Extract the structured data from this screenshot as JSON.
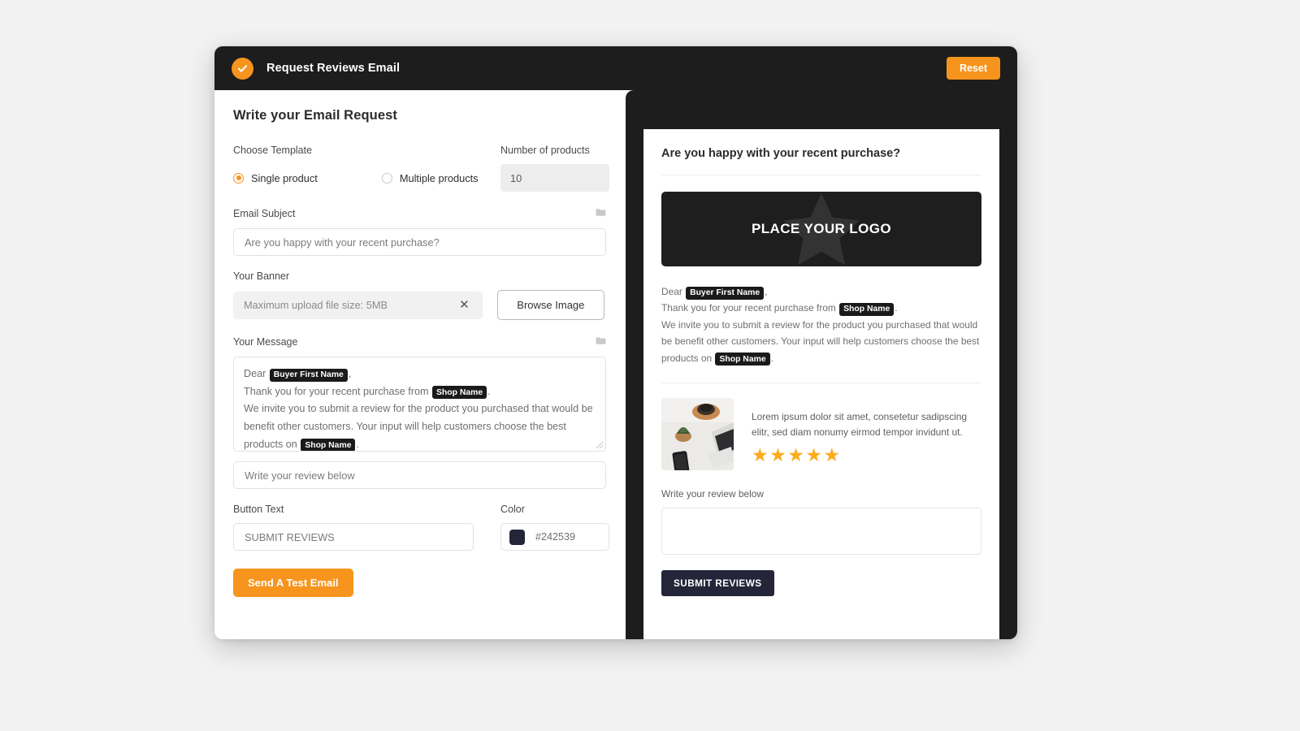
{
  "window": {
    "title": "Request Reviews Email",
    "brand_icon": "check-circle-icon",
    "reset_label": "Reset",
    "accent_color": "#f7941d",
    "titlebar_color": "#1d1d1d"
  },
  "form": {
    "panel_title": "Write your Email Request",
    "template": {
      "label": "Choose Template",
      "options": [
        {
          "label": "Single product",
          "selected": true
        },
        {
          "label": "Multiple products",
          "selected": false
        }
      ]
    },
    "number_of_products": {
      "label": "Number of products",
      "value": "10"
    },
    "email_subject": {
      "label": "Email Subject",
      "value": "Are you happy with your recent purchase?",
      "icon": "folder-icon"
    },
    "banner": {
      "label": "Your Banner",
      "upload_text": "Maximum upload file size: 5MB",
      "clear_icon": "close-icon",
      "browse_label": "Browse Image"
    },
    "message": {
      "label": "Your Message",
      "icon": "folder-icon",
      "line1_pre": "Dear ",
      "line1_token": "Buyer First Name",
      "line1_post": ",",
      "line2_pre": "Thank you for your recent purchase from ",
      "line2_token": "Shop Name",
      "line2_post": ".",
      "line3_pre": "We invite you to submit a review for the product you purchased that would be benefit other customers. Your input will help customers choose the best products on ",
      "line3_token": "Shop Name",
      "line3_post": "."
    },
    "review_prompt": {
      "value": "Write your review below"
    },
    "button_text": {
      "label": "Button Text",
      "value": "SUBMIT REVIEWS"
    },
    "color": {
      "label": "Color",
      "value": "#242539"
    },
    "send_test_label": "Send A Test Email"
  },
  "preview": {
    "heading": "Are you happy with your recent purchase?",
    "logo_placeholder": "PLACE YOUR LOGO",
    "logo_watermark_icon": "star-icon",
    "body": {
      "line1_pre": "Dear ",
      "line1_token": "Buyer First Name",
      "line1_post": ",",
      "line2_pre": "Thank you for your recent purchase from ",
      "line2_token": "Shop Name",
      "line2_post": ".",
      "line3_pre": "We invite you to submit a review for the product you purchased that would be benefit other customers. Your input will help customers choose the best products on ",
      "line3_token": "Shop Name",
      "line3_post": "."
    },
    "product": {
      "image_alt": "desk-flatlay-photo",
      "description": "Lorem ipsum dolor sit amet, consetetur sadipscing elitr, sed diam nonumy eirmod tempor invidunt ut.",
      "rating": 5,
      "star_glyph": "★",
      "star_color": "#fbab1c"
    },
    "review_label": "Write your review below",
    "submit_label": "SUBMIT REVIEWS",
    "submit_color": "#242539"
  }
}
